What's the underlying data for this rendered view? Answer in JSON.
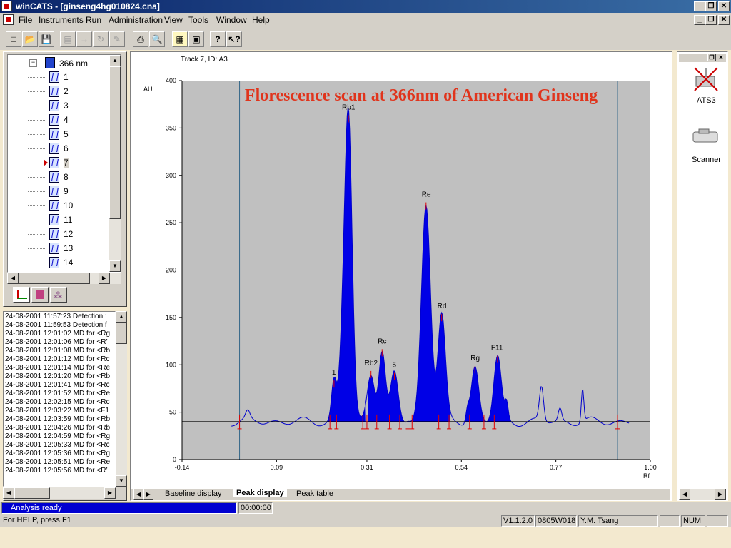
{
  "window": {
    "title": "winCATS - [ginseng4hg010824.cna]"
  },
  "menu": [
    {
      "label": "File",
      "accel": "F"
    },
    {
      "label": "Instruments",
      "accel": "I"
    },
    {
      "label": "Run",
      "accel": "R"
    },
    {
      "label": "Administration",
      "accel": "m"
    },
    {
      "label": "View",
      "accel": "V"
    },
    {
      "label": "Tools",
      "accel": "T"
    },
    {
      "label": "Window",
      "accel": "W"
    },
    {
      "label": "Help",
      "accel": "H"
    }
  ],
  "toolbar": [
    {
      "name": "new-file",
      "glyph": "□"
    },
    {
      "name": "open-file",
      "glyph": "📂"
    },
    {
      "name": "save-file",
      "glyph": "💾"
    },
    {
      "name": "disabled-1",
      "glyph": "▤"
    },
    {
      "name": "disabled-2",
      "glyph": "→"
    },
    {
      "name": "disabled-3",
      "glyph": "↻"
    },
    {
      "name": "disabled-4",
      "glyph": "✎"
    },
    {
      "name": "print",
      "glyph": "⎙"
    },
    {
      "name": "print-preview",
      "glyph": "🔍"
    },
    {
      "name": "view-1",
      "glyph": "▦"
    },
    {
      "name": "view-2",
      "glyph": "▣"
    },
    {
      "name": "help",
      "glyph": "?"
    },
    {
      "name": "context-help",
      "glyph": "↖?"
    }
  ],
  "tree": {
    "root": "366 nm",
    "items": [
      "1",
      "2",
      "3",
      "4",
      "5",
      "6",
      "7",
      "8",
      "9",
      "10",
      "11",
      "12",
      "13",
      "14"
    ],
    "selected": "7"
  },
  "log": [
    "24-08-2001 11:57:23 Detection :",
    "24-08-2001 11:59:53 Detection f",
    "24-08-2001 12:01:02 MD for <Rg",
    "24-08-2001 12:01:06 MD for <R’",
    "24-08-2001 12:01:08 MD for <Rb",
    "24-08-2001 12:01:12 MD for <Rc",
    "24-08-2001 12:01:14 MD for <Re",
    "24-08-2001 12:01:20 MD for <Rb",
    "24-08-2001 12:01:41 MD for <Rc",
    "24-08-2001 12:01:52 MD for <Re",
    "24-08-2001 12:02:15 MD for <Rc",
    "24-08-2001 12:03:22 MD for <F1",
    "24-08-2001 12:03:59 MD for <Rb",
    "24-08-2001 12:04:26 MD for <Rb",
    "24-08-2001 12:04:59 MD for <Rg",
    "24-08-2001 12:05:33 MD for <Rc",
    "24-08-2001 12:05:36 MD for <Rg",
    "24-08-2001 12:05:51 MD for <Re",
    "24-08-2001 12:05:56 MD for <R’"
  ],
  "chart_header": "Track 7, ID: A3",
  "tabs": [
    "Baseline display",
    "Peak display",
    "Peak table"
  ],
  "active_tab": "Peak display",
  "devices": [
    {
      "label": "ATS3"
    },
    {
      "label": "Scanner"
    }
  ],
  "status": {
    "analysis": "Analysis ready",
    "time": "00:00:00",
    "help": "For HELP, press F1",
    "version": "V1.1.2.0",
    "code": "0805W018",
    "user": "Y.M. Tsang",
    "num": "NUM"
  },
  "colors": {
    "fill": "#0000e6",
    "plot_bg": "#c0c0c0",
    "title": "#e0341c",
    "marker": "#e00000",
    "baseline": "#000000",
    "trace": "#0000cc"
  },
  "chart_data": {
    "type": "line",
    "title": "Florescence scan at 366nm of American Ginseng",
    "xlabel": "Rf",
    "ylabel": "AU",
    "xlim": [
      -0.14,
      1.0
    ],
    "ylim": [
      0,
      400
    ],
    "xticks": [
      "-0.14",
      "0.09",
      "0.31",
      "0.54",
      "0.77",
      "1.00"
    ],
    "yticks": [
      "0",
      "50",
      "100",
      "150",
      "200",
      "250",
      "300",
      "350",
      "400"
    ],
    "baseline": 40,
    "vertical_lines": [
      0.0,
      0.92
    ],
    "peaks": [
      {
        "label": "1",
        "rf": 0.23,
        "height": 82,
        "width": 0.006,
        "filled": true
      },
      {
        "label": "",
        "rf": 0.25,
        "height": 100,
        "width": 0.008,
        "filled": true
      },
      {
        "label": "Rb1",
        "rf": 0.265,
        "height": 362,
        "width": 0.009,
        "filled": true
      },
      {
        "label": "Rb2",
        "rf": 0.32,
        "height": 92,
        "width": 0.009,
        "filled": true
      },
      {
        "label": "Rc",
        "rf": 0.347,
        "height": 115,
        "width": 0.008,
        "filled": true
      },
      {
        "label": "5",
        "rf": 0.377,
        "height": 90,
        "width": 0.009,
        "filled": true
      },
      {
        "label": "",
        "rf": 0.41,
        "height": 42,
        "width": 0.004,
        "filled": true
      },
      {
        "label": "Re",
        "rf": 0.454,
        "height": 270,
        "width": 0.011,
        "filled": true
      },
      {
        "label": "Rd",
        "rf": 0.492,
        "height": 152,
        "width": 0.009,
        "filled": true
      },
      {
        "label": "",
        "rf": 0.555,
        "height": 53,
        "width": 0.004,
        "filled": false
      },
      {
        "label": "Rg",
        "rf": 0.573,
        "height": 97,
        "width": 0.009,
        "filled": true
      },
      {
        "label": "F11",
        "rf": 0.628,
        "height": 108,
        "width": 0.009,
        "filled": true
      },
      {
        "label": "",
        "rf": 0.65,
        "height": 57,
        "width": 0.004,
        "filled": false
      },
      {
        "label": "",
        "rf": 0.735,
        "height": 76,
        "width": 0.005,
        "filled": false
      },
      {
        "label": "",
        "rf": 0.78,
        "height": 53,
        "width": 0.004,
        "filled": false
      },
      {
        "label": "",
        "rf": 0.835,
        "height": 75,
        "width": 0.003,
        "filled": false
      },
      {
        "label": "",
        "rf": 0.02,
        "height": 48,
        "width": 0.005,
        "filled": false
      }
    ],
    "fill_ranges": [
      [
        0.215,
        0.308
      ],
      [
        0.312,
        0.4
      ],
      [
        0.405,
        0.418
      ],
      [
        0.42,
        0.512
      ],
      [
        0.54,
        0.604
      ],
      [
        0.605,
        0.66
      ]
    ],
    "markers": [
      0.0,
      0.22,
      0.236,
      0.3,
      0.31,
      0.334,
      0.365,
      0.39,
      0.41,
      0.42,
      0.485,
      0.51,
      0.56,
      0.595,
      0.62,
      0.92
    ]
  }
}
